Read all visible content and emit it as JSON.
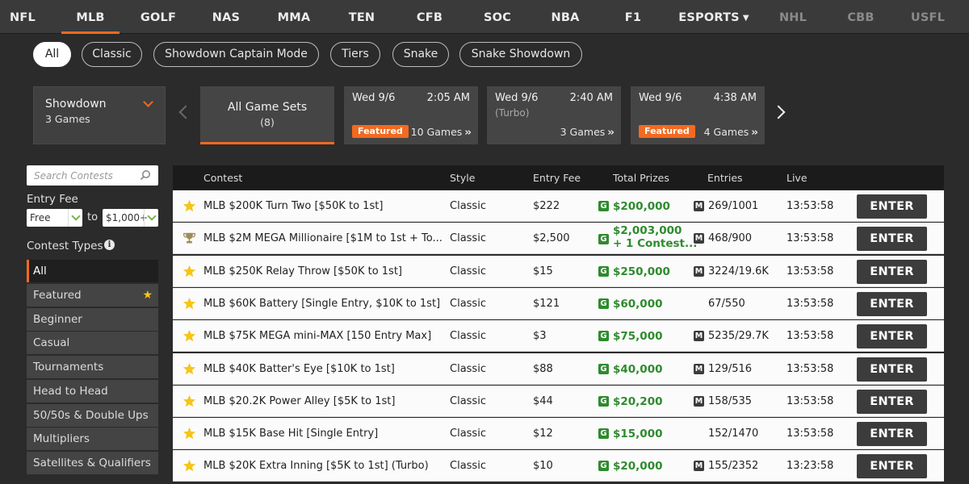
{
  "nav": {
    "sports": [
      {
        "label": "NFL"
      },
      {
        "label": "MLB"
      },
      {
        "label": "GOLF"
      },
      {
        "label": "NAS"
      },
      {
        "label": "MMA"
      },
      {
        "label": "TEN"
      },
      {
        "label": "CFB"
      },
      {
        "label": "SOC"
      },
      {
        "label": "NBA"
      },
      {
        "label": "F1"
      },
      {
        "label": "ESPORTS"
      },
      {
        "label": "NHL"
      },
      {
        "label": "CBB"
      },
      {
        "label": "USFL"
      }
    ],
    "active": "MLB",
    "accent_color": "#f26a21"
  },
  "filters": {
    "pills": [
      "All",
      "Classic",
      "Showdown Captain Mode",
      "Tiers",
      "Snake",
      "Snake Showdown"
    ],
    "active": "All"
  },
  "gamesets": {
    "selector_title": "Showdown",
    "selector_subtitle": "3 Games",
    "all_label": "All Game Sets",
    "all_count": "(8)",
    "cards": [
      {
        "date": "Wed 9/6",
        "time": "2:05 AM",
        "sub": "",
        "featured": "Featured",
        "games": "10 Games"
      },
      {
        "date": "Wed 9/6",
        "time": "2:40 AM",
        "sub": "(Turbo)",
        "featured": "",
        "games": "3 Games"
      },
      {
        "date": "Wed 9/6",
        "time": "4:38 AM",
        "sub": "",
        "featured": "Featured",
        "games": "4 Games"
      }
    ]
  },
  "sidebar": {
    "search_placeholder": "Search Contests",
    "entry_fee_label": "Entry Fee",
    "fee_from": "Free",
    "fee_to_label": "to",
    "fee_to": "$1,000+",
    "contest_types_label": "Contest Types",
    "types": [
      {
        "label": "All"
      },
      {
        "label": "Featured"
      },
      {
        "label": "Beginner"
      },
      {
        "label": "Casual"
      },
      {
        "label": "Tournaments"
      },
      {
        "label": "Head to Head"
      },
      {
        "label": "50/50s & Double Ups"
      },
      {
        "label": "Multipliers"
      },
      {
        "label": "Satellites & Qualifiers"
      }
    ]
  },
  "table": {
    "headers": {
      "contest": "Contest",
      "style": "Style",
      "fee": "Entry Fee",
      "prizes": "Total Prizes",
      "entries": "Entries",
      "live": "Live"
    },
    "enter_label": "ENTER",
    "rows": [
      {
        "icon": "star-icon",
        "name": "MLB $200K Turn Two [$50K to 1st]",
        "style": "Classic",
        "fee": "$222",
        "prize": "$200,000",
        "prize_extra": "",
        "multi": true,
        "entries": "269/1001",
        "live": "13:53:58"
      },
      {
        "icon": "trophy-icon",
        "name": "MLB $2M MEGA Millionaire [$1M to 1st + To...",
        "style": "Classic",
        "fee": "$2,500",
        "prize": "$2,003,000",
        "prize_extra": "+ 1 Contest...",
        "multi": true,
        "entries": "468/900",
        "live": "13:53:58"
      },
      {
        "icon": "star-icon",
        "name": "MLB $250K Relay Throw [$50K to 1st]",
        "style": "Classic",
        "fee": "$15",
        "prize": "$250,000",
        "prize_extra": "",
        "multi": true,
        "entries": "3224/19.6K",
        "live": "13:53:58"
      },
      {
        "icon": "star-icon",
        "name": "MLB $60K Battery [Single Entry, $10K to 1st]",
        "style": "Classic",
        "fee": "$121",
        "prize": "$60,000",
        "prize_extra": "",
        "multi": false,
        "entries": "67/550",
        "live": "13:53:58"
      },
      {
        "icon": "star-icon",
        "name": "MLB $75K MEGA mini-MAX [150 Entry Max]",
        "style": "Classic",
        "fee": "$3",
        "prize": "$75,000",
        "prize_extra": "",
        "multi": true,
        "entries": "5235/29.7K",
        "live": "13:53:58"
      },
      {
        "icon": "star-icon",
        "name": "MLB $40K Batter's Eye [$10K to 1st]",
        "style": "Classic",
        "fee": "$88",
        "prize": "$40,000",
        "prize_extra": "",
        "multi": true,
        "entries": "129/516",
        "live": "13:53:58"
      },
      {
        "icon": "star-icon",
        "name": "MLB $20.2K Power Alley [$5K to 1st]",
        "style": "Classic",
        "fee": "$44",
        "prize": "$20,200",
        "prize_extra": "",
        "multi": true,
        "entries": "158/535",
        "live": "13:53:58"
      },
      {
        "icon": "star-icon",
        "name": "MLB $15K Base Hit [Single Entry]",
        "style": "Classic",
        "fee": "$12",
        "prize": "$15,000",
        "prize_extra": "",
        "multi": false,
        "entries": "152/1470",
        "live": "13:53:58"
      },
      {
        "icon": "star-icon",
        "name": "MLB $20K Extra Inning [$5K to 1st] (Turbo)",
        "style": "Classic",
        "fee": "$10",
        "prize": "$20,000",
        "prize_extra": "",
        "multi": true,
        "entries": "155/2352",
        "live": "13:23:58"
      }
    ]
  }
}
